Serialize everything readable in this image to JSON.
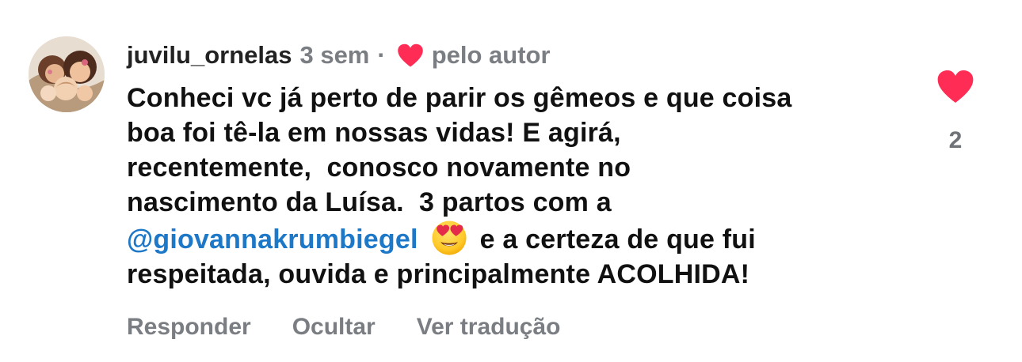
{
  "comment": {
    "username": "juvilu_ornelas",
    "time": "3 sem",
    "separator": "·",
    "liked_by_author": "pelo autor",
    "lines": [
      "Conheci vc já perto de parir os gêmeos e que coisa",
      "boa foi tê-la em nossas vidas! E agirá,",
      "recentemente,  conosco novamente no",
      "nascimento da Luísa.  3 partos com a"
    ],
    "mention": "@giovannakrumbiegel",
    "emoji": "heart-eyes-emoji",
    "after_mention": "e a certeza de que fui",
    "last_line": "respeitada, ouvida e principalmente ACOLHIDA!",
    "like_count": "2"
  },
  "actions": {
    "reply": "Responder",
    "hide": "Ocultar",
    "translate": "Ver tradução"
  },
  "colors": {
    "heart": "#ff2d55",
    "mention": "#1e78c8",
    "muted": "#7a7d82",
    "text": "#111111"
  },
  "icons": {
    "avatar": "profile-photo",
    "mini_heart": "heart-icon",
    "like": "heart-filled-icon"
  }
}
